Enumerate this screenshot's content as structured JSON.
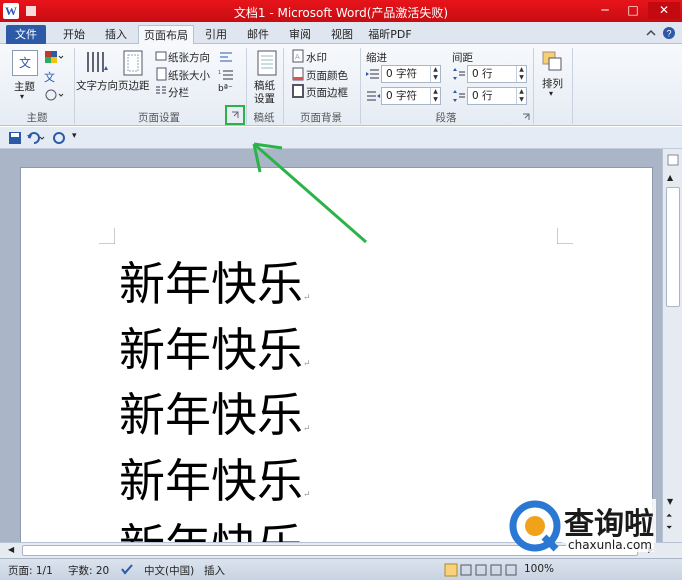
{
  "window": {
    "title": "文档1 - Microsoft Word(产品激活失败)",
    "app_icon_letter": "W",
    "min_glyph": "─",
    "max_glyph": "□",
    "close_glyph": "✕"
  },
  "tabs": [
    {
      "label": "文件"
    },
    {
      "label": "开始"
    },
    {
      "label": "插入"
    },
    {
      "label": "页面布局"
    },
    {
      "label": "引用"
    },
    {
      "label": "邮件"
    },
    {
      "label": "审阅"
    },
    {
      "label": "视图"
    },
    {
      "label": "福昕PDF"
    }
  ],
  "ribbon": {
    "theme": {
      "theme_label": "主题",
      "icon_label": "文",
      "group": "主题",
      "color_icon": "palette-icon",
      "font_icon_label": "文"
    },
    "page_setup": {
      "text_direction": "文字方向",
      "margins": "页边距",
      "orientation": "纸张方向",
      "size": "纸张大小",
      "columns": "分栏",
      "group": "页面设置",
      "hyphen_label": "bª⁻"
    },
    "draft": {
      "label_line1": "稿纸",
      "label_line2": "设置",
      "group": "稿纸"
    },
    "background": {
      "watermark": "水印",
      "page_color": "页面颜色",
      "page_border": "页面边框",
      "group": "页面背景"
    },
    "paragraph": {
      "indent_title": "缩进",
      "spacing_title": "间距",
      "indent_left": "0 字符",
      "indent_right": "0 字符",
      "space_before": "0 行",
      "space_after": "0 行",
      "group": "段落"
    },
    "arrange": {
      "label": "排列"
    }
  },
  "document": {
    "lines": [
      "新年快乐",
      "新年快乐",
      "新年快乐",
      "新年快乐",
      "新年快乐"
    ],
    "para_mark": "↵"
  },
  "status": {
    "page": "页面: 1/1",
    "words": "字数: 20",
    "language": "中文(中国)",
    "mode": "插入",
    "zoom": "100%"
  },
  "watermark": {
    "brand_cn": "查询啦",
    "brand_url": "chaxunla.com"
  },
  "colors": {
    "title_bar": "#d3101a",
    "file_tab": "#2c5aa7",
    "annotation_green": "#2bb34a"
  }
}
